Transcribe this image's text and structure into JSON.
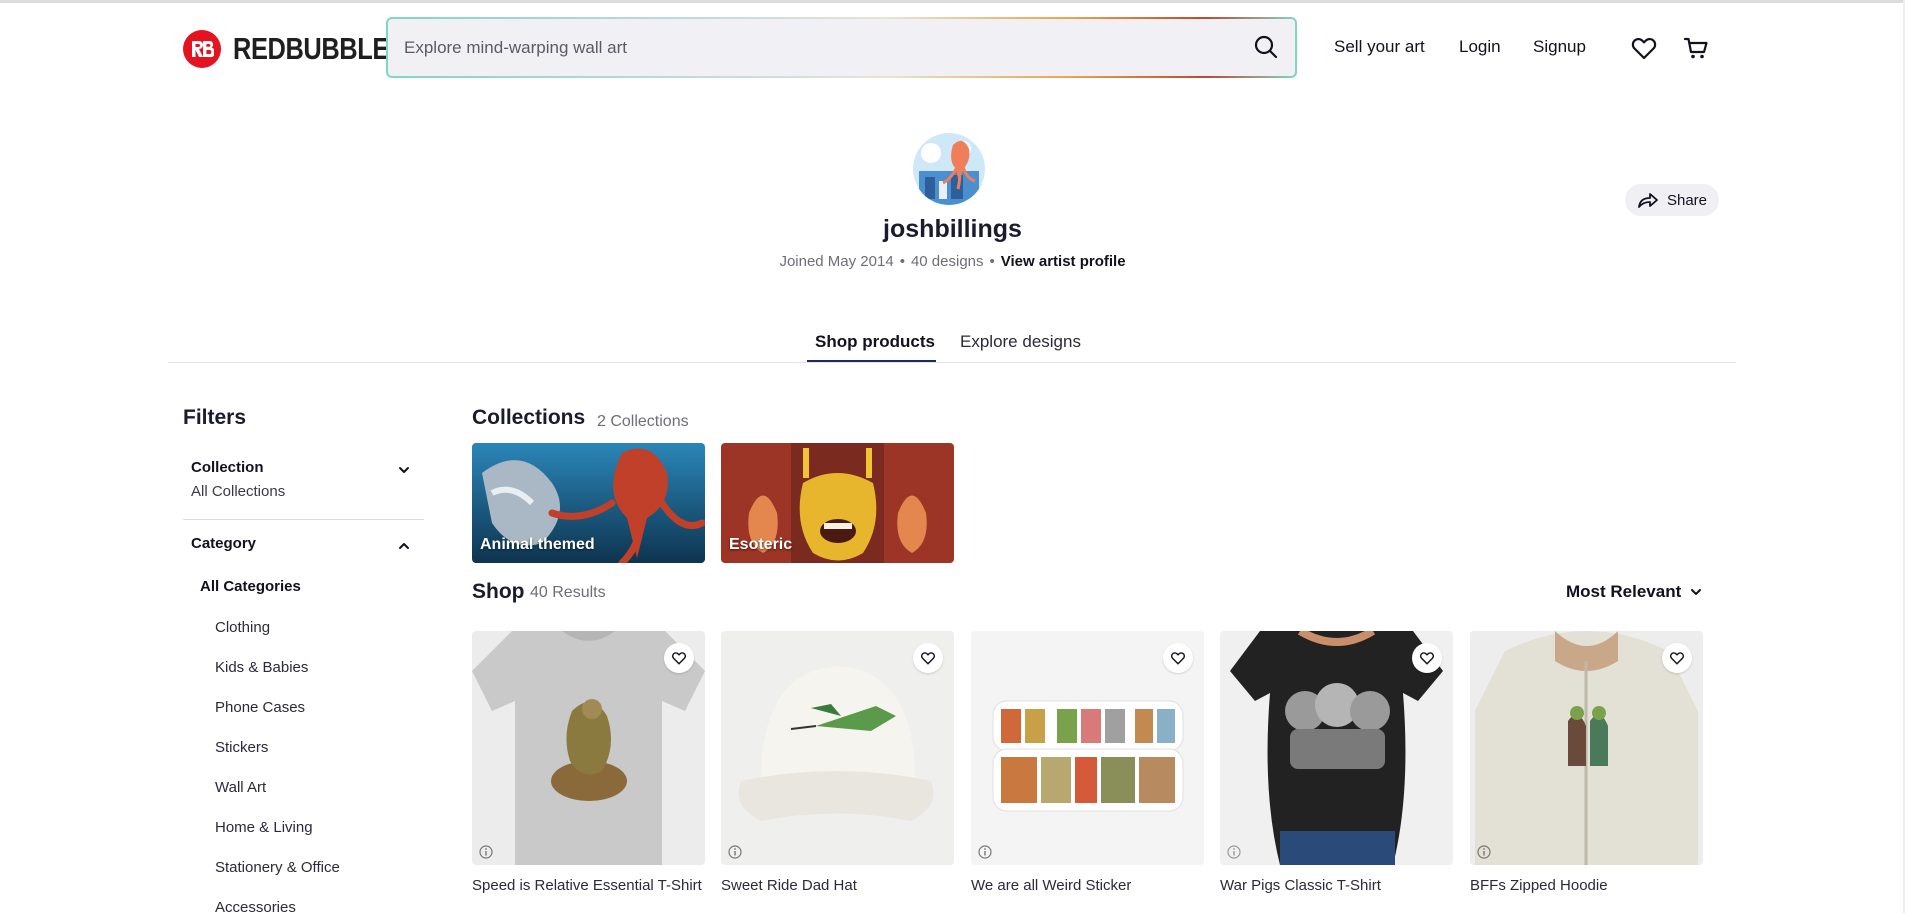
{
  "header": {
    "brand": "REDBUBBLE",
    "search_placeholder": "Explore mind-warping wall art",
    "nav": {
      "sell": "Sell your art",
      "login": "Login",
      "signup": "Signup"
    }
  },
  "profile": {
    "username": "joshbillings",
    "joined": "Joined May 2014",
    "designs": "40 designs",
    "view_profile": "View artist profile",
    "share_label": "Share"
  },
  "tabs": {
    "shop": "Shop products",
    "explore": "Explore designs"
  },
  "filters": {
    "title": "Filters",
    "collection": {
      "label": "Collection",
      "value": "All Collections"
    },
    "category": {
      "label": "Category",
      "all": "All Categories",
      "items": [
        "Clothing",
        "Kids & Babies",
        "Phone Cases",
        "Stickers",
        "Wall Art",
        "Home & Living",
        "Stationery & Office",
        "Accessories"
      ]
    }
  },
  "collections": {
    "title": "Collections",
    "count": "2 Collections",
    "items": [
      {
        "label": "Animal themed"
      },
      {
        "label": "Esoteric"
      }
    ]
  },
  "shop": {
    "title": "Shop",
    "count": "40 Results",
    "sort": "Most Relevant",
    "products": [
      {
        "title": "Speed is Relative Essential T-Shirt"
      },
      {
        "title": "Sweet Ride Dad Hat"
      },
      {
        "title": "We are all Weird Sticker"
      },
      {
        "title": "War Pigs Classic T-Shirt"
      },
      {
        "title": "BFFs Zipped Hoodie"
      }
    ]
  },
  "colors": {
    "brand_red": "#e41321",
    "tab_underline": "#1d2a5b",
    "price": "#3a3aa0"
  }
}
